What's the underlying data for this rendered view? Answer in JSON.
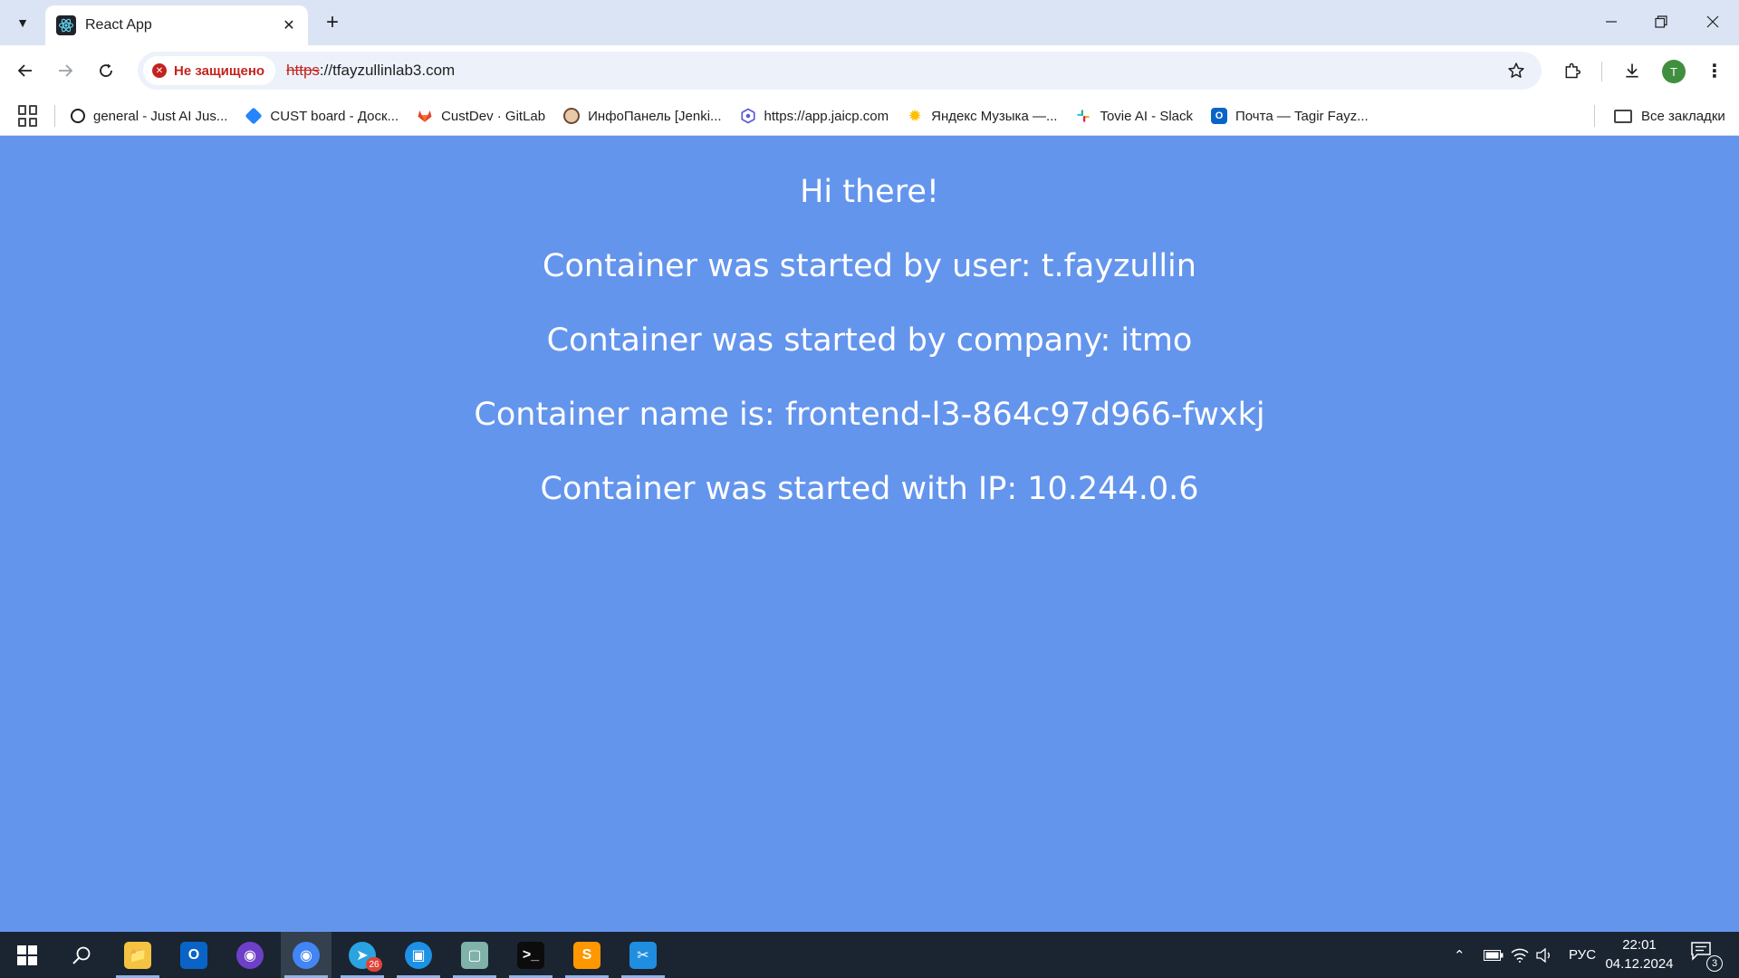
{
  "browser": {
    "tab": {
      "title": "React App",
      "close_icon": "close-icon",
      "favicon": "react-logo-icon"
    },
    "window_controls": [
      "minimize-icon",
      "restore-icon",
      "close-icon"
    ],
    "security_label": "Не защищено",
    "url": {
      "scheme": "https",
      "rest": "://tfayzullinlab3.com"
    },
    "profile_initial": "T",
    "bookmarks": [
      {
        "label": "general - Just AI Jus...",
        "icon": "just-ai-icon",
        "color": "#1f1f1f"
      },
      {
        "label": "CUST board - Доск...",
        "icon": "jira-icon",
        "color": "#2684ff"
      },
      {
        "label": "CustDev · GitLab",
        "icon": "gitlab-icon",
        "color": "#e24329"
      },
      {
        "label": "ИнфоПанель [Jenki...",
        "icon": "jenkins-icon",
        "color": "#d24939"
      },
      {
        "label": "https://app.jaicp.com",
        "icon": "jaicp-icon",
        "color": "#5b5bd6"
      },
      {
        "label": "Яндекс Музыка —...",
        "icon": "yandex-music-icon",
        "color": "#ffcc00"
      },
      {
        "label": "Tovie AI - Slack",
        "icon": "slack-icon",
        "color": "#4a154b"
      },
      {
        "label": "Почта — Tagir Fayz...",
        "icon": "outlook-icon",
        "color": "#0a64c8"
      }
    ],
    "all_bookmarks_label": "Все закладки"
  },
  "page": {
    "greeting": "Hi there!",
    "user_line": "Container was started by user: t.fayzullin",
    "company_line": "Container was started by company: itmo",
    "name_line": "Container name is: frontend-l3-864c97d966-fwxkj",
    "ip_line": "Container was started with IP: 10.244.0.6",
    "background_color": "#6495ED"
  },
  "taskbar": {
    "apps": [
      {
        "name": "file-explorer-icon",
        "color": "#f5c342",
        "running": true,
        "active": false
      },
      {
        "name": "outlook-icon",
        "color": "#0a64c8",
        "running": false,
        "active": false
      },
      {
        "name": "github-desktop-icon",
        "color": "#6e40c9",
        "running": false,
        "active": false
      },
      {
        "name": "chrome-icon",
        "color": "#4285f4",
        "running": true,
        "active": true
      },
      {
        "name": "telegram-icon",
        "color": "#2aa3e0",
        "running": true,
        "active": false,
        "badge": "26"
      },
      {
        "name": "docker-icon",
        "color": "#1d91e6",
        "running": true,
        "active": false
      },
      {
        "name": "notes-app-icon",
        "color": "#7fb2a8",
        "running": true,
        "active": false
      },
      {
        "name": "terminal-icon",
        "color": "#0c0c0c",
        "running": true,
        "active": false
      },
      {
        "name": "sublime-text-icon",
        "color": "#ff9800",
        "running": true,
        "active": false
      },
      {
        "name": "snipping-tool-icon",
        "color": "#1f8ee0",
        "running": true,
        "active": false
      }
    ],
    "language": "РУС",
    "time": "22:01",
    "date": "04.12.2024",
    "notifications": "3"
  }
}
